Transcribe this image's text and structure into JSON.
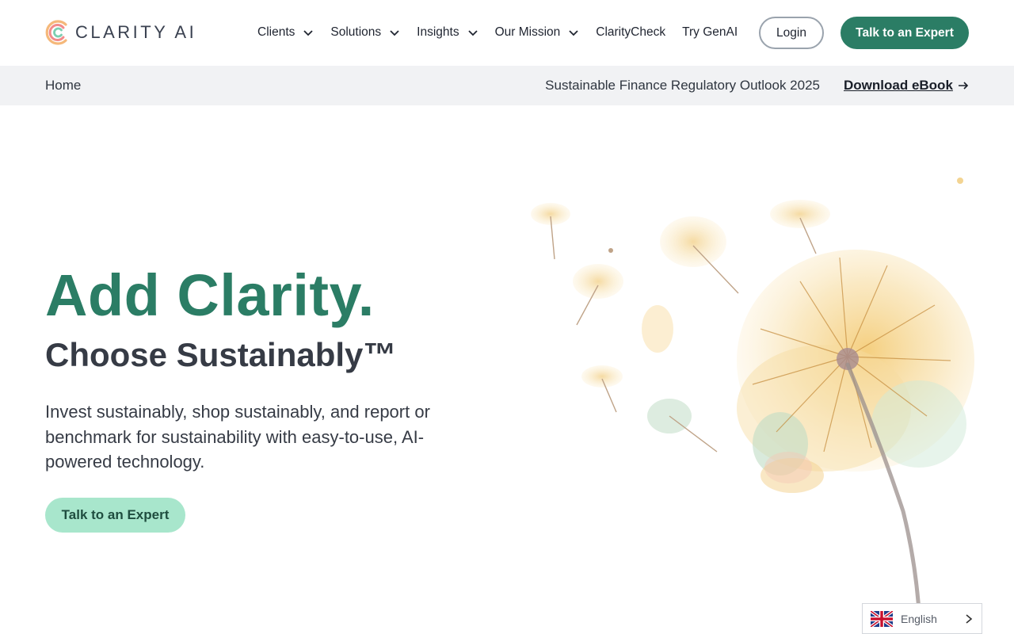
{
  "header": {
    "logo_text": "CLARITY AI",
    "nav": [
      {
        "label": "Clients",
        "has_dropdown": true
      },
      {
        "label": "Solutions",
        "has_dropdown": true
      },
      {
        "label": "Insights",
        "has_dropdown": true
      },
      {
        "label": "Our Mission",
        "has_dropdown": true
      },
      {
        "label": "ClarityCheck",
        "has_dropdown": false
      },
      {
        "label": "Try GenAI",
        "has_dropdown": false
      }
    ],
    "login_label": "Login",
    "cta_label": "Talk to an Expert"
  },
  "subbar": {
    "breadcrumb": "Home",
    "promo_text": "Sustainable Finance Regulatory Outlook 2025",
    "download_label": "Download eBook"
  },
  "hero": {
    "title": "Add Clarity.",
    "subtitle": "Choose Sustainably™",
    "body": "Invest sustainably, shop sustainably, and report or benchmark for sustainability with easy-to-use, AI-powered technology.",
    "button_label": "Talk to an Expert"
  },
  "language": {
    "selected": "English",
    "flag_icon": "uk-flag-icon"
  },
  "colors": {
    "brand_green": "#2b7d65",
    "light_green": "#a8e6cc",
    "subbar_bg": "#f1f2f4",
    "text_dark": "#363b45"
  }
}
